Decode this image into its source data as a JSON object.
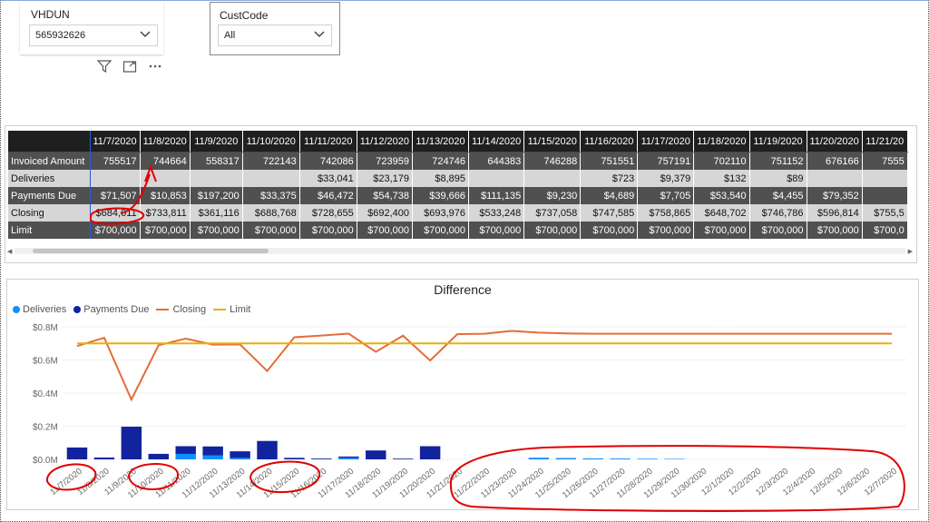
{
  "slicers": [
    {
      "label": "VHDUN",
      "value": "565932626"
    },
    {
      "label": "CustCode",
      "value": "All"
    }
  ],
  "toolbar_icons": [
    "filter-icon",
    "focus-mode-icon",
    "more-options-icon"
  ],
  "matrix": {
    "columns": [
      "11/7/2020",
      "11/8/2020",
      "11/9/2020",
      "11/10/2020",
      "11/11/2020",
      "11/12/2020",
      "11/13/2020",
      "11/14/2020",
      "11/15/2020",
      "11/16/2020",
      "11/17/2020",
      "11/18/2020",
      "11/19/2020",
      "11/20/2020",
      "11/21/20"
    ],
    "rows": [
      {
        "label": "Invoiced Amount",
        "values": [
          "755517",
          "744664",
          "558317",
          "722143",
          "742086",
          "723959",
          "724746",
          "644383",
          "746288",
          "751551",
          "757191",
          "702110",
          "751152",
          "676166",
          "7555"
        ]
      },
      {
        "label": "Deliveries",
        "values": [
          "",
          "",
          "",
          "",
          "$33,041",
          "$23,179",
          "$8,895",
          "",
          "",
          "$723",
          "$9,379",
          "$132",
          "$89",
          "",
          ""
        ]
      },
      {
        "label": "Payments Due",
        "values": [
          "$71,507",
          "$10,853",
          "$197,200",
          "$33,375",
          "$46,472",
          "$54,738",
          "$39,666",
          "$111,135",
          "$9,230",
          "$4,689",
          "$7,705",
          "$53,540",
          "$4,455",
          "$79,352",
          ""
        ]
      },
      {
        "label": "Closing",
        "values": [
          "$684,011",
          "$733,811",
          "$361,116",
          "$688,768",
          "$728,655",
          "$692,400",
          "$693,976",
          "$533,248",
          "$737,058",
          "$747,585",
          "$758,865",
          "$648,702",
          "$746,786",
          "$596,814",
          "$755,5"
        ]
      },
      {
        "label": "Limit",
        "values": [
          "$700,000",
          "$700,000",
          "$700,000",
          "$700,000",
          "$700,000",
          "$700,000",
          "$700,000",
          "$700,000",
          "$700,000",
          "$700,000",
          "$700,000",
          "$700,000",
          "$700,000",
          "$700,000",
          "$700,0"
        ]
      }
    ]
  },
  "chart_data": {
    "type": "bar",
    "title": "Difference",
    "legend_position": "top-left",
    "series": [
      {
        "name": "Deliveries",
        "kind": "bar",
        "color": "#118DFF",
        "values": [
          0,
          0,
          0,
          0,
          33041,
          23179,
          8895,
          0,
          0,
          723,
          9379,
          132,
          89,
          0,
          0,
          0,
          0,
          10000,
          8000,
          6000,
          5000,
          4000,
          3000,
          0,
          0,
          0,
          0,
          0,
          0,
          0,
          0
        ]
      },
      {
        "name": "Payments Due",
        "kind": "bar",
        "color": "#12239E",
        "values": [
          71507,
          10853,
          197200,
          33375,
          46472,
          54738,
          39666,
          111135,
          9230,
          4689,
          7705,
          53540,
          4455,
          79352,
          0,
          0,
          0,
          0,
          0,
          0,
          0,
          0,
          0,
          0,
          0,
          0,
          0,
          0,
          0,
          0,
          0
        ]
      },
      {
        "name": "Closing",
        "kind": "line",
        "color": "#E66C37",
        "values": [
          684011,
          733811,
          361116,
          688768,
          728655,
          692400,
          693976,
          533248,
          737058,
          747585,
          758865,
          648702,
          746786,
          596814,
          755500,
          758000,
          775000,
          765000,
          760000,
          758000,
          758000,
          758000,
          758000,
          758000,
          758000,
          758000,
          758000,
          758000,
          758000,
          758000,
          758000
        ]
      },
      {
        "name": "Limit",
        "kind": "line",
        "color": "#E8B008",
        "values": [
          700000,
          700000,
          700000,
          700000,
          700000,
          700000,
          700000,
          700000,
          700000,
          700000,
          700000,
          700000,
          700000,
          700000,
          700000,
          700000,
          700000,
          700000,
          700000,
          700000,
          700000,
          700000,
          700000,
          700000,
          700000,
          700000,
          700000,
          700000,
          700000,
          700000,
          700000
        ]
      }
    ],
    "x": [
      "11/7/2020",
      "11/8/2020",
      "11/9/2020",
      "11/10/2020",
      "11/11/2020",
      "11/12/2020",
      "11/13/2020",
      "11/14/2020",
      "11/15/2020",
      "11/16/2020",
      "11/17/2020",
      "11/18/2020",
      "11/19/2020",
      "11/20/2020",
      "11/21/2020",
      "11/22/2020",
      "11/23/2020",
      "11/24/2020",
      "11/25/2020",
      "11/26/2020",
      "11/27/2020",
      "11/28/2020",
      "11/29/2020",
      "11/30/2020",
      "12/1/2020",
      "12/2/2020",
      "12/3/2020",
      "12/4/2020",
      "12/5/2020",
      "12/6/2020",
      "12/7/2020"
    ],
    "yticks": [
      0,
      200000,
      400000,
      600000,
      800000
    ],
    "ytick_labels": [
      "$0.0M",
      "$0.2M",
      "$0.4M",
      "$0.6M",
      "$0.8M"
    ],
    "ylim": [
      0,
      800000
    ]
  },
  "annotations": {
    "color": "#E00000",
    "note": "red hand-drawn circles around selected date labels and the $684,011 Closing cell, with an arrow pointing to 11/8/2020"
  }
}
